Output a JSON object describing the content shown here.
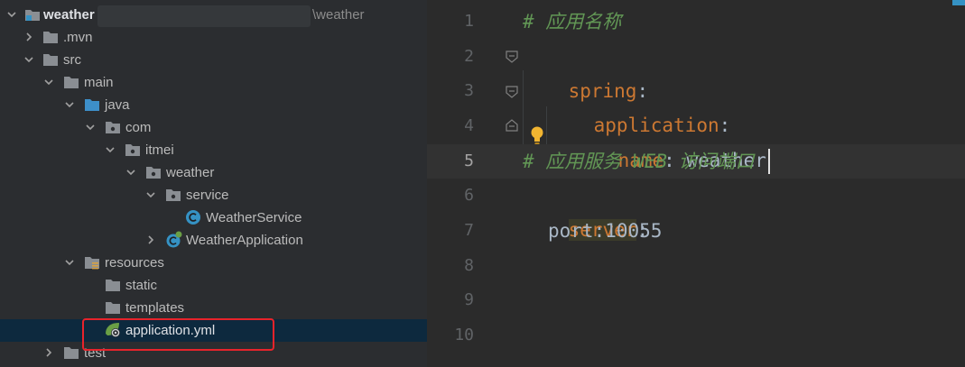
{
  "project": {
    "root_label": "weather",
    "root_path_suffix": "\\weather",
    "items": [
      {
        "label": ".mvn"
      },
      {
        "label": "src"
      },
      {
        "label": "main"
      },
      {
        "label": "java"
      },
      {
        "label": "com"
      },
      {
        "label": "itmei"
      },
      {
        "label": "weather"
      },
      {
        "label": "service"
      },
      {
        "label": "WeatherService"
      },
      {
        "label": "WeatherApplication"
      },
      {
        "label": "resources"
      },
      {
        "label": "static"
      },
      {
        "label": "templates"
      },
      {
        "label": "application.yml"
      },
      {
        "label": "test"
      }
    ]
  },
  "editor": {
    "line_numbers": [
      "1",
      "2",
      "3",
      "4",
      "5",
      "6",
      "7",
      "8",
      "9",
      "10"
    ],
    "current_line": "5",
    "lines": {
      "l1_comment": "# 应用名称",
      "l2_key": "spring",
      "l2_colon": ":",
      "l3_key": "application",
      "l3_colon": ":",
      "l4_key": "name",
      "l4_rest": ": weather",
      "l5_comment": "# 应用服务 WEB 访问端口",
      "l6_key": "server",
      "l6_colon": ":",
      "l7_text": "port:10055"
    }
  },
  "colors": {
    "tree_bg": "#2b2d30",
    "editor_bg": "#2b2b2b",
    "selection": "#0d293e",
    "highlight_box": "#e8232b",
    "yaml_key": "#cc7832",
    "comment": "#629755"
  }
}
